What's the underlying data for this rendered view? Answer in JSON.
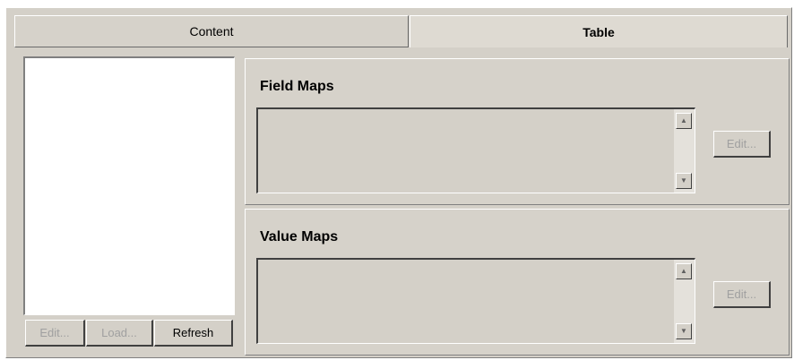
{
  "tabs": [
    {
      "label": "Content",
      "selected": false
    },
    {
      "label": "Table",
      "selected": true
    }
  ],
  "left_list": {
    "items": [],
    "buttons": {
      "edit": {
        "label": "Edit...",
        "enabled": false
      },
      "load": {
        "label": "Load...",
        "enabled": false
      },
      "refresh": {
        "label": "Refresh",
        "enabled": true
      }
    }
  },
  "field_maps": {
    "title": "Field Maps",
    "items": [],
    "edit_button": {
      "label": "Edit...",
      "enabled": false
    }
  },
  "value_maps": {
    "title": "Value Maps",
    "items": [],
    "edit_button": {
      "label": "Edit...",
      "enabled": false
    }
  },
  "icons": {
    "scroll_up": "scroll-up-arrow-icon",
    "scroll_down": "scroll-down-arrow-icon"
  }
}
